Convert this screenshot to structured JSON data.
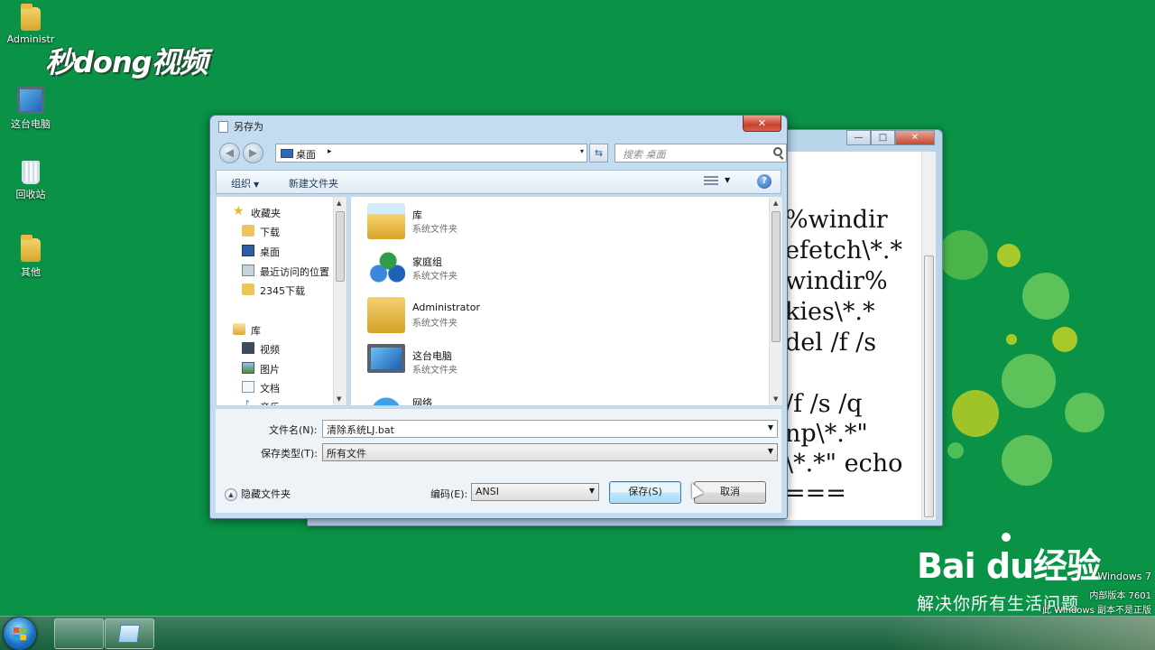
{
  "desktop": {
    "icons": [
      {
        "label": "Administr",
        "kind": "folder"
      },
      {
        "label": "这台电脑",
        "kind": "pc"
      },
      {
        "label": "回收站",
        "kind": "bin"
      },
      {
        "label": "其他",
        "kind": "folder"
      }
    ],
    "watermark_logo": "秒dong视频",
    "baidu_logo": "Bai du经验",
    "baidu_tagline": "解决你所有生活问题",
    "windows_version_lines": [
      "Windows 7",
      "内部版本 7601",
      "此 Windows 副本不是正版"
    ]
  },
  "background_window": {
    "controls": [
      "—",
      "□",
      "✕"
    ],
    "code_lines": [
      "%windir",
      "efetch\\*.*",
      "windir%",
      "kies\\*.*",
      " del /f /s",
      "/f /s /q",
      "np\\*.*\"",
      "\\*.*\" echo",
      "==="
    ]
  },
  "dialog": {
    "title": "另存为",
    "close": "✕",
    "address": {
      "location": "桌面",
      "separator": "▸",
      "dropdown": "▾"
    },
    "search": {
      "placeholder": "搜索 桌面"
    },
    "toolbar": {
      "organize": "组织",
      "new_folder": "新建文件夹",
      "help": "?"
    },
    "nav_tree": [
      {
        "label": "收藏夹",
        "icon": "star",
        "indent": 0
      },
      {
        "label": "下载",
        "icon": "download",
        "indent": 1
      },
      {
        "label": "桌面",
        "icon": "desktop",
        "indent": 1
      },
      {
        "label": "最近访问的位置",
        "icon": "recent",
        "indent": 1
      },
      {
        "label": "2345下载",
        "icon": "folder",
        "indent": 1
      },
      {
        "label": "库",
        "icon": "library",
        "indent": 0
      },
      {
        "label": "视频",
        "icon": "video",
        "indent": 1
      },
      {
        "label": "图片",
        "icon": "picture",
        "indent": 1
      },
      {
        "label": "文档",
        "icon": "document",
        "indent": 1
      },
      {
        "label": "音乐",
        "icon": "music",
        "indent": 1
      }
    ],
    "files": [
      {
        "name": "库",
        "type": "系统文件夹",
        "icon": "library"
      },
      {
        "name": "家庭组",
        "type": "系统文件夹",
        "icon": "homegroup"
      },
      {
        "name": "Administrator",
        "type": "系统文件夹",
        "icon": "user-folder"
      },
      {
        "name": "这台电脑",
        "type": "系统文件夹",
        "icon": "computer"
      },
      {
        "name": "网络",
        "type": "",
        "icon": "network"
      }
    ],
    "filename_label": "文件名(N):",
    "filename_value": "清除系统LJ.bat",
    "filetype_label": "保存类型(T):",
    "filetype_value": "所有文件",
    "hide_folders": "隐藏文件夹",
    "encoding_label": "编码(E):",
    "encoding_value": "ANSI",
    "save_button": "保存(S)",
    "cancel_button": "取消"
  },
  "colors": {
    "desktop_bg": "#0a9246",
    "dialog_frame": "#c3dcf0",
    "primary_button": "#bee6fd"
  }
}
